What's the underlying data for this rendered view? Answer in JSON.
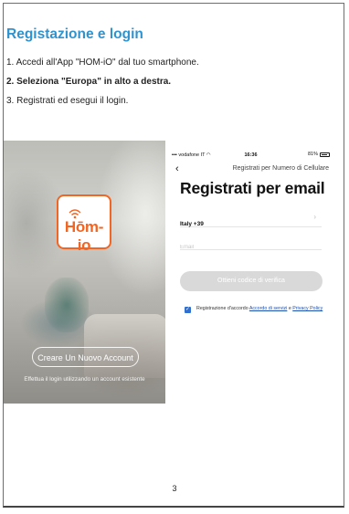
{
  "title": "Registazione e login",
  "steps": [
    "1. Accedi all'App \"HOM-iO\" dal tuo smartphone.",
    "2. Seleziona \"Europa\" in alto a destra.",
    "3. Registrati ed esegui il login."
  ],
  "splash": {
    "logo_text": "Hōm-io",
    "create_account_label": "Creare Un Nuovo Account",
    "login_existing_text": "Effettua il login utilizzando un account esistente"
  },
  "register": {
    "status": {
      "carrier": "vodafone IT",
      "time": "16:36",
      "battery": "81%"
    },
    "nav_title": "Registrati per Numero di Cellulare",
    "heading": "Registrati per email",
    "country": "Italy +39",
    "email_placeholder": "Email",
    "verify_button": "Ottieni codice di verifica",
    "agree_prefix": "Registrazione d'accordo ",
    "agree_link_terms": "Accordo di servizi",
    "agree_and": " e ",
    "agree_link_privacy": "Privacy Policy"
  },
  "page_number": "3",
  "colors": {
    "title_blue": "#2f93cf",
    "brand_orange": "#f26522",
    "checkbox_blue": "#2f6fd1"
  }
}
